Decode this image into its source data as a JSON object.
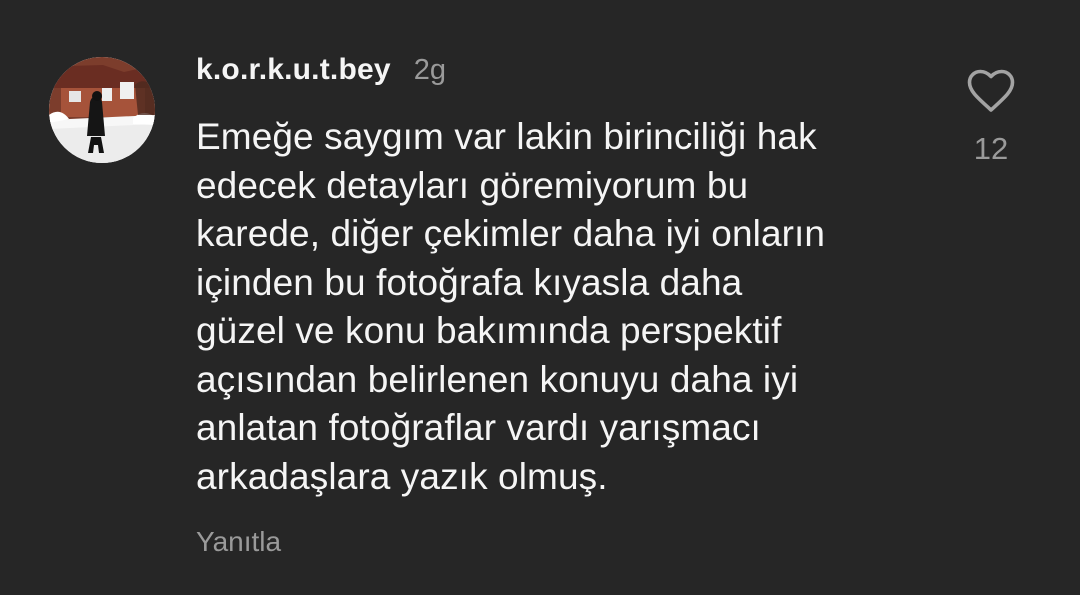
{
  "comment": {
    "username": "k.o.r.k.u.t.bey",
    "timestamp": "2g",
    "text": "Emeğe saygım var lakin birinciliği hak\nedecek detayları göremiyorum bu\nkarede, diğer çekimler daha iyi onların\niçinden bu fotoğrafa kıyasla daha\ngüzel ve konu bakımında perspektif\naçısından belirlenen konuyu daha  iyi\nanlatan fotoğraflar vardı yarışmacı\narkadaşlara yazık olmuş.",
    "reply_label": "Yanıtla",
    "like_count": "12",
    "like_icon": "heart-outline-icon"
  },
  "colors": {
    "background": "#262626",
    "primary_text": "#f5f5f5",
    "secondary_text": "#9a9a9a"
  }
}
